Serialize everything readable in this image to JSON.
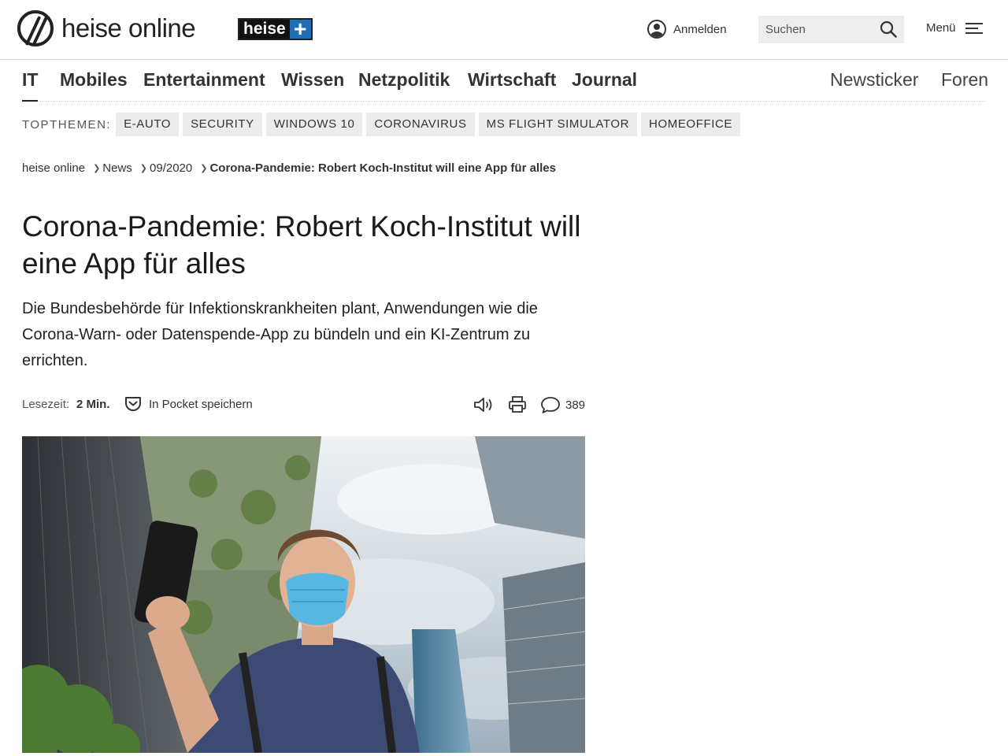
{
  "brand": {
    "name": "heise online",
    "plus_word": "heise",
    "plus_sign": "+"
  },
  "header": {
    "login_label": "Anmelden",
    "search_placeholder": "Suchen",
    "menu_label": "Menü"
  },
  "sections": {
    "items": [
      "IT",
      "Mobiles",
      "Entertainment",
      "Wissen",
      "Netzpolitik",
      "Wirtschaft",
      "Journal"
    ],
    "right": [
      "Newsticker",
      "Foren"
    ]
  },
  "topthemen": {
    "label": "TOPTHEMEN:",
    "chips": [
      "E-AUTO",
      "SECURITY",
      "WINDOWS 10",
      "CORONAVIRUS",
      "MS FLIGHT SIMULATOR",
      "HOMEOFFICE"
    ]
  },
  "breadcrumb": {
    "items": [
      "heise online",
      "News",
      "09/2020"
    ],
    "current": "Corona-Pandemie: Robert Koch-Institut will eine App für alles"
  },
  "article": {
    "title": "Corona-Pandemie: Robert Koch-Institut will eine App für alles",
    "lead": "Die Bundesbehörde für Infektionskrankheiten plant, Anwendungen wie die Corona-Warn- oder Datenspende-App zu bündeln und ein KI-Zentrum zu errichten."
  },
  "meta": {
    "reading_label": "Lesezeit:",
    "reading_time": "2 Min.",
    "pocket_label": "In Pocket speichern",
    "comment_count": "389"
  },
  "icons": [
    "user-icon",
    "search-icon",
    "hamburger-icon",
    "pocket-icon",
    "speaker-icon",
    "printer-icon",
    "comment-icon"
  ]
}
